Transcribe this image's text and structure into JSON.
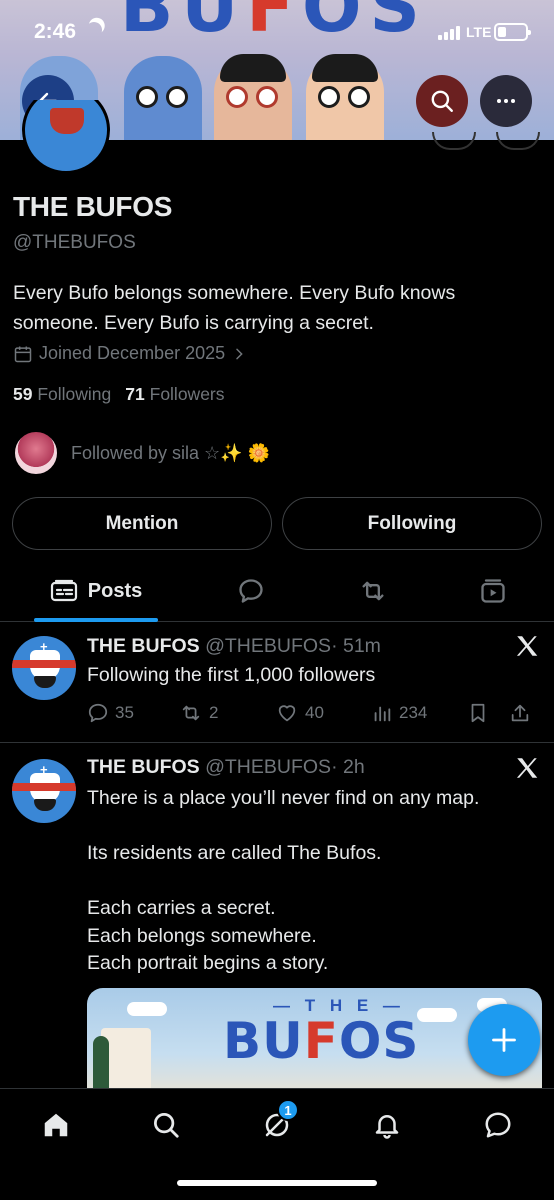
{
  "status_bar": {
    "time": "2:46",
    "network": "LTE"
  },
  "profile": {
    "name": "THE BUFOS",
    "handle": "@THEBUFOS",
    "bio": "Every Bufo belongs somewhere. Every Bufo knows someone. Every Bufo is carrying a secret.",
    "joined": "Joined December 2025",
    "following_count": "59",
    "following_label": "Following",
    "followers_count": "71",
    "followers_label": "Followers",
    "followed_by": "Followed by sila ☆✨ 🌼"
  },
  "buttons": {
    "mention": "Mention",
    "following": "Following"
  },
  "tabs": {
    "posts": "Posts"
  },
  "posts": [
    {
      "name": "THE BUFOS",
      "handle": "@THEBUFOS",
      "time": "· 51m",
      "text": "Following the first 1,000 followers",
      "replies": "35",
      "reposts": "2",
      "likes": "40",
      "views": "234"
    },
    {
      "name": "THE BUFOS",
      "handle": "@THEBUFOS",
      "time": "· 2h",
      "lines": [
        "There is a place you’ll never find on any map.",
        "",
        "Its residents are called The Bufos.",
        "",
        "Each carries a secret.",
        "Each belongs somewhere.",
        "Each portrait begins a story."
      ],
      "media": {
        "top": "— T H E —",
        "title_1": "BU",
        "title_2": "F",
        "title_3": "OS"
      }
    }
  ],
  "banner": {
    "text_1": "BU",
    "text_2": "F",
    "text_3": "OS"
  },
  "bottom_nav": {
    "grok_badge": "1"
  },
  "colors": {
    "accent": "#1d9bf0",
    "muted": "#71767b",
    "text": "#e7e9ea",
    "background": "#000000"
  }
}
